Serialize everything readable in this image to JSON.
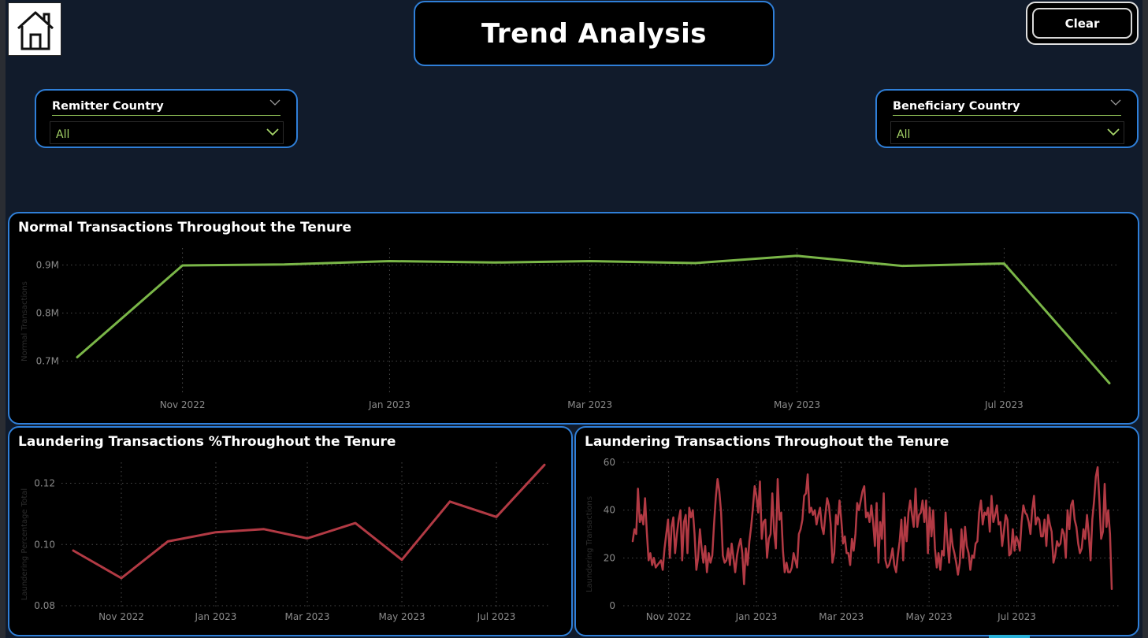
{
  "page": {
    "title": "Trend Analysis",
    "clear_label": "Clear"
  },
  "icons": {
    "home": "home-icon",
    "chevron": "chevron-down-icon"
  },
  "colors": {
    "accent": "#2f7fd8",
    "normal_line": "#7ab648",
    "laundering_line": "#b23a44",
    "slicer_value": "#a5d468"
  },
  "filters": [
    {
      "label": "Remitter Country",
      "value": "All"
    },
    {
      "label": "Beneficiary Country",
      "value": "All"
    }
  ],
  "chart_data": [
    {
      "type": "line",
      "title": "Normal Transactions Throughout the Tenure",
      "ylabel": "Normal Transactions",
      "xlabel": "",
      "x": [
        "2022-10-01",
        "2022-11-01",
        "2022-12-01",
        "2023-01-01",
        "2023-02-01",
        "2023-03-01",
        "2023-04-01",
        "2023-05-01",
        "2023-06-01",
        "2023-07-01",
        "2023-08-01"
      ],
      "values": [
        0.708,
        0.899,
        0.901,
        0.908,
        0.905,
        0.908,
        0.904,
        0.919,
        0.898,
        0.903,
        0.654
      ],
      "x_ticks": [
        "Nov 2022",
        "Jan 2023",
        "Mar 2023",
        "May 2023",
        "Jul 2023"
      ],
      "y_ticks": [
        "0.7M",
        "0.8M",
        "0.9M"
      ],
      "ylim": [
        0.64,
        0.94
      ],
      "grid": true
    },
    {
      "type": "line",
      "title": "Laundering Transactions %Throughout the Tenure",
      "ylabel": "Laundering Percentage Total",
      "xlabel": "",
      "x": [
        "2022-10-01",
        "2022-11-01",
        "2022-12-01",
        "2023-01-01",
        "2023-02-01",
        "2023-03-01",
        "2023-04-01",
        "2023-05-01",
        "2023-06-01",
        "2023-07-01",
        "2023-08-01"
      ],
      "values": [
        0.098,
        0.089,
        0.101,
        0.104,
        0.105,
        0.102,
        0.107,
        0.095,
        0.114,
        0.109,
        0.126
      ],
      "x_ticks": [
        "Nov 2022",
        "Jan 2023",
        "Mar 2023",
        "May 2023",
        "Jul 2023"
      ],
      "y_ticks": [
        "0.08",
        "0.10",
        "0.12"
      ],
      "ylim": [
        0.08,
        0.133
      ],
      "grid": true
    },
    {
      "type": "line",
      "title": "Laundering Transactions Throughout the Tenure",
      "ylabel": "Laundering Transactions",
      "xlabel": "",
      "x_start": "2022-10-07",
      "x_end": "2023-09-05",
      "values": [
        27,
        32,
        30,
        49,
        35,
        38,
        34,
        45,
        31,
        19,
        22,
        17,
        20,
        16,
        17,
        18,
        19,
        15,
        24,
        30,
        36,
        20,
        33,
        37,
        22,
        30,
        36,
        40,
        19,
        35,
        38,
        22,
        41,
        37,
        40,
        30,
        15,
        20,
        32,
        24,
        18,
        25,
        14,
        22,
        18,
        21,
        34,
        45,
        53,
        48,
        39,
        21,
        18,
        19,
        24,
        17,
        26,
        20,
        14,
        21,
        25,
        28,
        22,
        9,
        24,
        17,
        27,
        33,
        41,
        50,
        46,
        39,
        52,
        28,
        35,
        36,
        20,
        28,
        30,
        47,
        31,
        24,
        53,
        36,
        39,
        23,
        14,
        18,
        14,
        14,
        16,
        22,
        19,
        16,
        30,
        32,
        36,
        46,
        47,
        55,
        39,
        41,
        38,
        40,
        34,
        38,
        41,
        33,
        30,
        38,
        45,
        42,
        34,
        18,
        22,
        38,
        34,
        44,
        36,
        26,
        29,
        22,
        22,
        17,
        28,
        23,
        30,
        43,
        40,
        44,
        48,
        50,
        37,
        39,
        35,
        42,
        35,
        25,
        43,
        18,
        35,
        28,
        47,
        19,
        16,
        17,
        20,
        24,
        17,
        14,
        21,
        27,
        36,
        19,
        37,
        27,
        39,
        44,
        38,
        33,
        49,
        33,
        38,
        39,
        44,
        35,
        44,
        22,
        41,
        29,
        40,
        24,
        16,
        22,
        15,
        23,
        21,
        39,
        27,
        18,
        32,
        25,
        22,
        18,
        13,
        18,
        32,
        20,
        33,
        25,
        22,
        15,
        21,
        20,
        26,
        27,
        39,
        44,
        34,
        39,
        38,
        41,
        31,
        46,
        35,
        38,
        42,
        34,
        35,
        25,
        31,
        38,
        36,
        21,
        22,
        32,
        23,
        29,
        27,
        23,
        35,
        42,
        39,
        38,
        35,
        30,
        40,
        46,
        34,
        37,
        36,
        29,
        29,
        36,
        25,
        38,
        34,
        31,
        18,
        21,
        27,
        25,
        26,
        32,
        30,
        20,
        40,
        32,
        42,
        44,
        36,
        33,
        26,
        22,
        24,
        32,
        28,
        38,
        30,
        19,
        36,
        44,
        54,
        58,
        44,
        28,
        31,
        51,
        33,
        40,
        30,
        7
      ],
      "x_ticks": [
        "Nov 2022",
        "Jan 2023",
        "Mar 2023",
        "May 2023",
        "Jul 2023"
      ],
      "y_ticks": [
        "0",
        "20",
        "40",
        "60"
      ],
      "ylim": [
        0,
        60
      ],
      "grid": true
    }
  ]
}
